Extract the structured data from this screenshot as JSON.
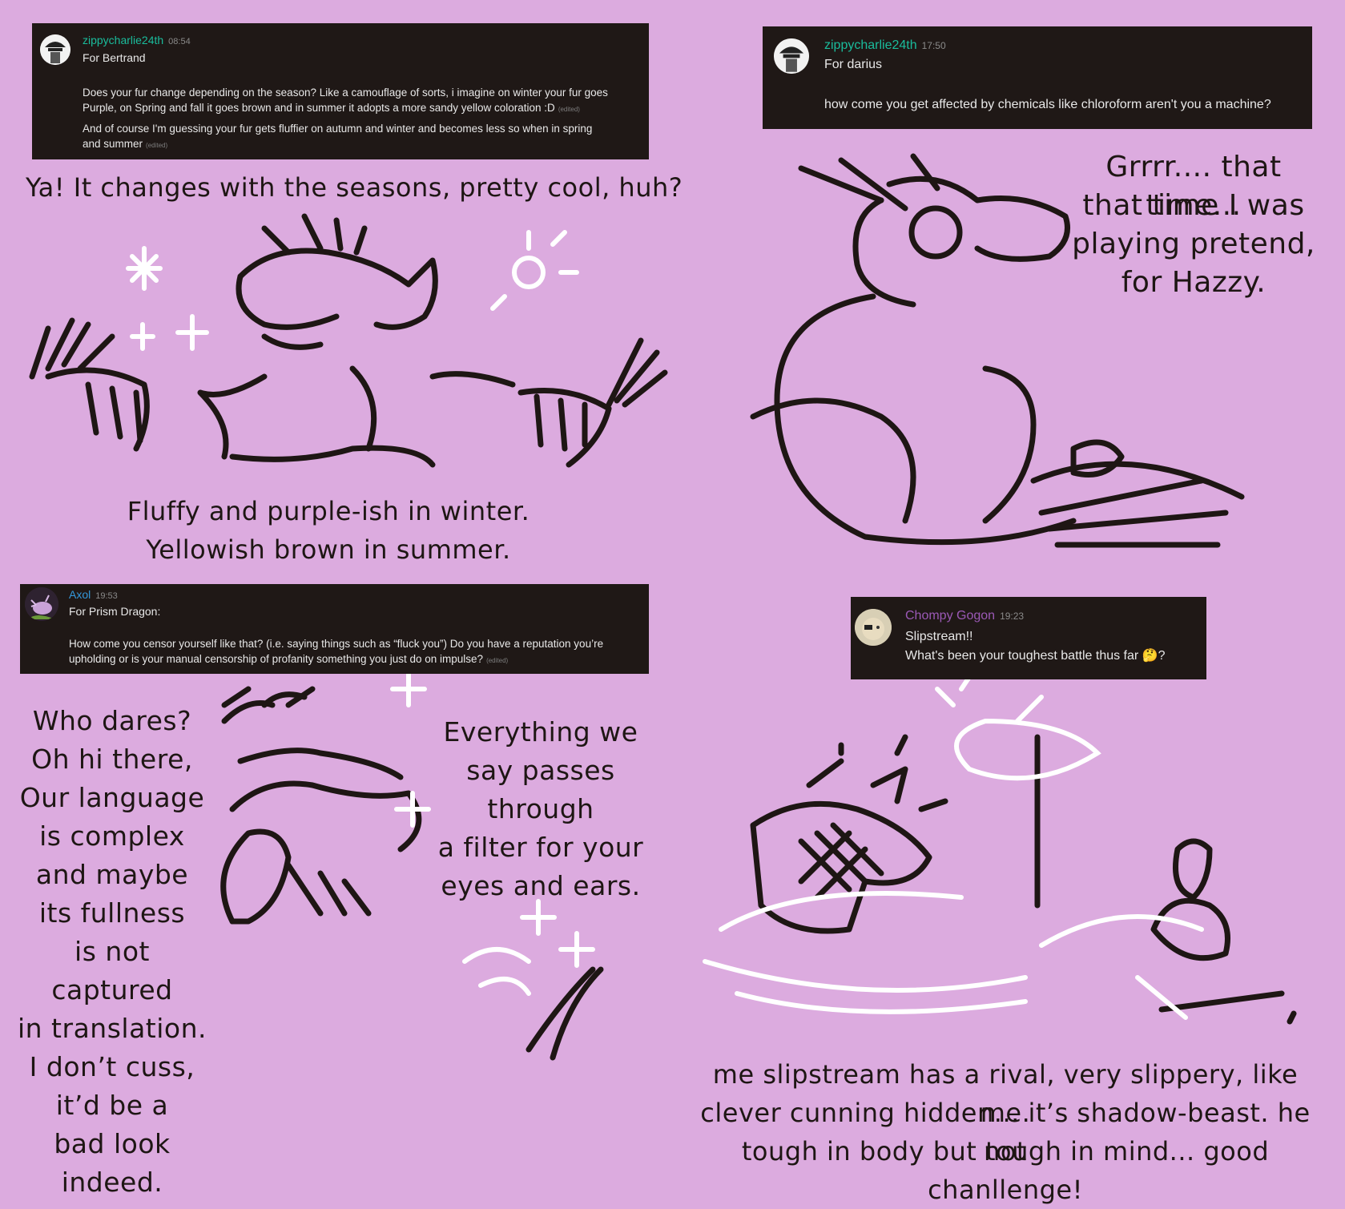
{
  "panels": {
    "bertrand": {
      "username": "zippycharlie24th",
      "time": "08:54",
      "for_line": "For Bertrand",
      "line1": "Does your fur change depending on the season? Like a camouflage of sorts, i imagine on winter your fur goes",
      "line2": "Purple, on Spring and fall it goes brown and in summer it adopts a more sandy yellow coloration :D",
      "line3": "And of course I'm guessing your fur gets fluffier on autumn and winter and becomes less so when in spring",
      "line4": "and summer",
      "edited": "(edited)",
      "caption_top": "Ya! It changes with the seasons, pretty cool, huh?",
      "caption_bottom_1": "Fluffy and purple-ish in winter.",
      "caption_bottom_2": "Yellowish brown in summer."
    },
    "darius": {
      "username": "zippycharlie24th",
      "time": "17:50",
      "for_line": "For darius",
      "question": "how come you get affected by chemicals like chloroform aren't you a machine?",
      "caption_1": "Grrrr.... that time...",
      "caption_2": "that time I was",
      "caption_3": "playing pretend,",
      "caption_4": "for Hazzy."
    },
    "prism": {
      "username": "Axol",
      "time": "19:53",
      "for_line": "For Prism Dragon:",
      "line1": "How come you censor yourself like that? (i.e. saying things such as “fluck you”) Do you have a reputation you’re",
      "line2": "upholding or is your manual censorship of profanity something you just do on impulse?",
      "edited": "(edited)",
      "left_lines": [
        "Who dares?",
        "Oh hi there,",
        "Our language",
        "is complex",
        "and maybe",
        "its fullness",
        "is not captured",
        "in translation.",
        "I don’t cuss,",
        "it’d be a",
        "bad look",
        "indeed."
      ],
      "right_lines": [
        "Everything we",
        "say passes through",
        "a filter for your",
        "eyes and ears."
      ]
    },
    "slipstream": {
      "username": "Chompy Gogon",
      "time": "19:23",
      "line1": "Slipstream!!",
      "line2": "What's been your toughest battle thus far",
      "line2_end": "?",
      "emoji": "🤔",
      "caption_1": "me slipstream has a rival, very slippery, like me.",
      "caption_2": "clever cunning hidden... it’s shadow-beast. he not",
      "caption_3": "tough in body but tough in mind... good chanllenge!"
    }
  },
  "colors": {
    "background": "#dcabdf",
    "panel": "#1f1816",
    "ink": "#1e1614",
    "zippy_name": "#1abc9c",
    "axol_name": "#3498db",
    "chompy_name": "#9b59b6"
  }
}
